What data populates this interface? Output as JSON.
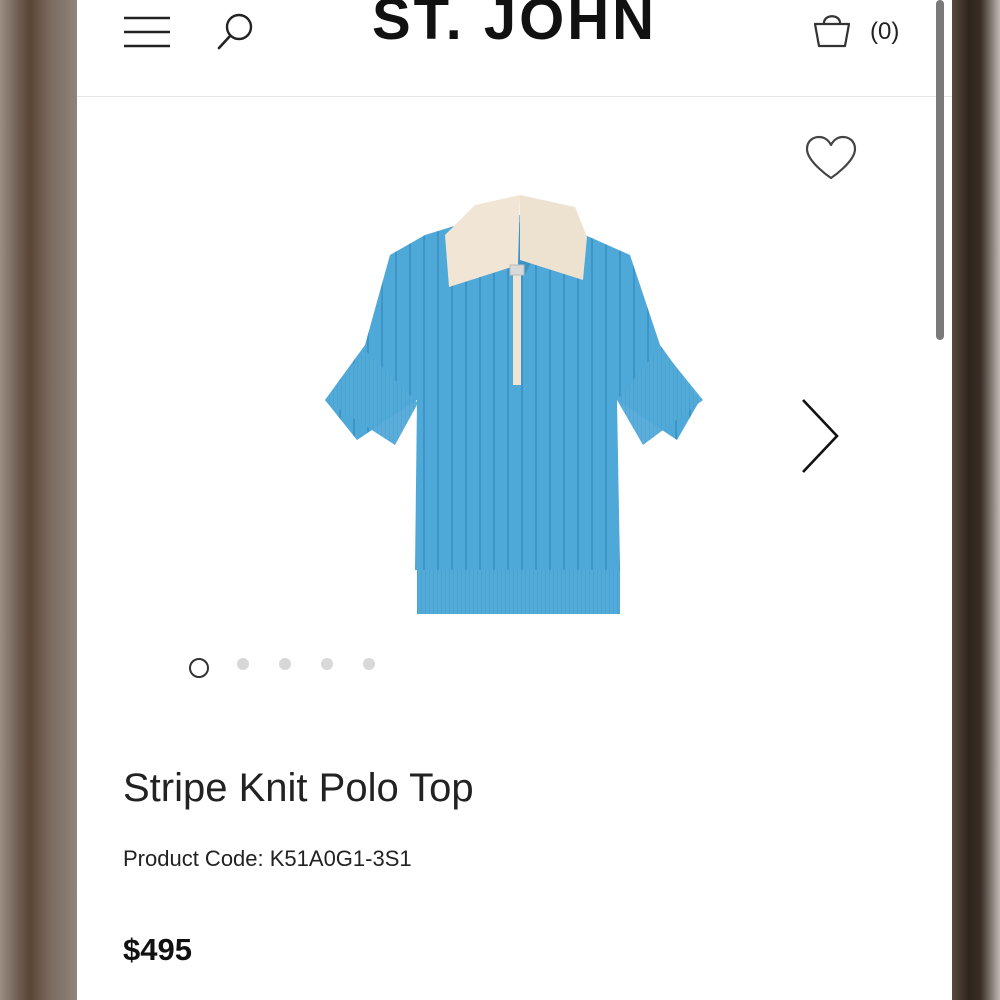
{
  "header": {
    "logo_text": "ST. JOHN",
    "cart_count": "(0)"
  },
  "icons": {
    "menu": "hamburger-menu-icon",
    "search": "search-icon",
    "cart": "shopping-bag-icon",
    "favorite": "heart-icon",
    "next": "chevron-right-icon"
  },
  "gallery": {
    "image_count": 5,
    "active_index": 0,
    "product_color": "#4da6d6",
    "collar_color": "#f1e6d6"
  },
  "product": {
    "title": "Stripe Knit Polo Top",
    "code": "Product Code: K51A0G1-3S1",
    "price": "$495"
  }
}
